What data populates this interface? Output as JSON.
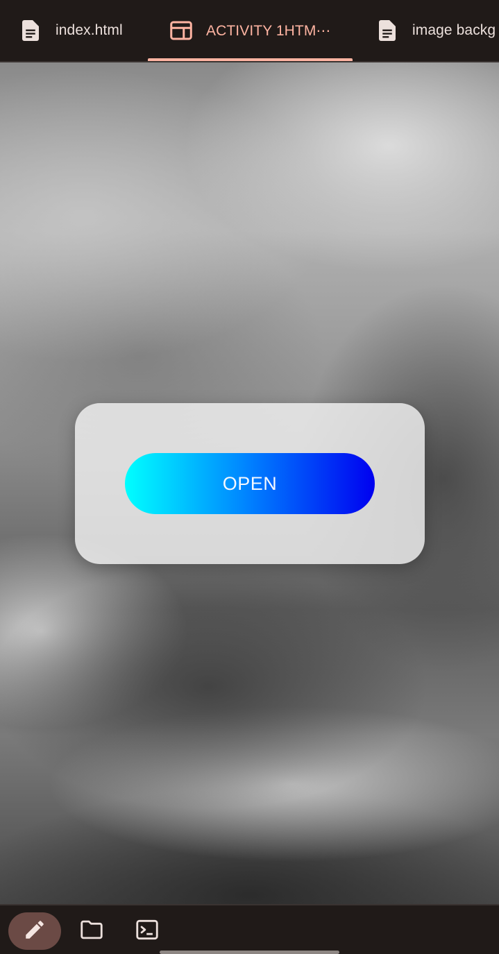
{
  "tabs": [
    {
      "label": "index.html",
      "icon": "document-icon",
      "active": false
    },
    {
      "label": "ACTIVITY 1HTM⋯",
      "icon": "web-preview-icon",
      "active": true
    },
    {
      "label": "image backg",
      "icon": "document-icon",
      "active": false
    }
  ],
  "preview": {
    "button_label": "OPEN"
  },
  "bottom_bar": {
    "items": [
      {
        "icon": "pencil-icon",
        "active": true
      },
      {
        "icon": "folder-icon",
        "active": false
      },
      {
        "icon": "terminal-icon",
        "active": false
      }
    ]
  },
  "colors": {
    "accent": "#ffb4a2",
    "bar_background": "#201a18",
    "active_chip": "#6b4a45",
    "button_gradient_start": "#00ffff",
    "button_gradient_end": "#0000f0"
  }
}
